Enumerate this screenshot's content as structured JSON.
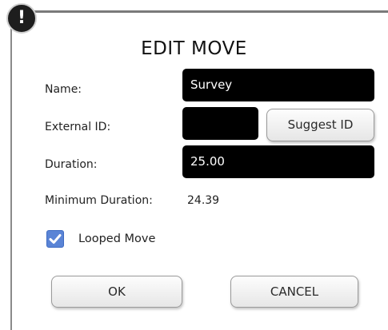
{
  "dialog": {
    "alert_glyph": "!",
    "title": "EDIT MOVE"
  },
  "form": {
    "name_label": "Name:",
    "name_value": "Survey",
    "external_id_label": "External ID:",
    "external_id_value": "",
    "suggest_id_label": "Suggest ID",
    "duration_label": "Duration:",
    "duration_value": "25.00",
    "min_duration_label": "Minimum Duration:",
    "min_duration_value": "24.39",
    "looped_label": "Looped Move",
    "looped_checked": true
  },
  "actions": {
    "ok_label": "OK",
    "cancel_label": "CANCEL"
  },
  "colors": {
    "field_bg": "#000000",
    "checkbox_accent": "#5a84d6",
    "alert_badge": "#1e1e1e"
  },
  "icons": {
    "alert": "exclamation-icon",
    "check": "checkmark-icon"
  }
}
